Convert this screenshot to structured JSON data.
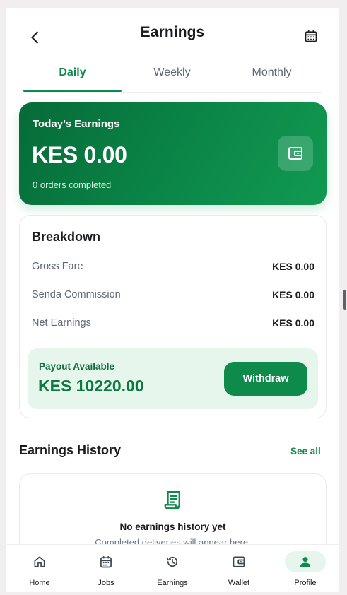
{
  "header": {
    "title": "Earnings",
    "back_icon": "chevron-left-icon",
    "calendar_icon": "calendar-icon"
  },
  "tabs": [
    {
      "label": "Daily",
      "active": true
    },
    {
      "label": "Weekly",
      "active": false
    },
    {
      "label": "Monthly",
      "active": false
    }
  ],
  "today": {
    "label": "Today’s Earnings",
    "amount": "KES 0.00",
    "orders": "0 orders completed",
    "icon": "wallet-icon"
  },
  "breakdown": {
    "title": "Breakdown",
    "rows": [
      {
        "label": "Gross Fare",
        "value": "KES 0.00"
      },
      {
        "label": "Senda Commission",
        "value": "KES 0.00"
      },
      {
        "label": "Net Earnings",
        "value": "KES 0.00"
      }
    ],
    "payout": {
      "label": "Payout Available",
      "amount": "KES 10220.00",
      "button": "Withdraw"
    }
  },
  "history": {
    "title": "Earnings History",
    "see_all": "See all",
    "empty_title": "No earnings history yet",
    "empty_subtitle": "Completed deliveries will appear here."
  },
  "nav": [
    {
      "label": "Home",
      "icon": "home-icon",
      "active": false
    },
    {
      "label": "Jobs",
      "icon": "calendar-icon",
      "active": false
    },
    {
      "label": "Earnings",
      "icon": "history-icon",
      "active": false
    },
    {
      "label": "Wallet",
      "icon": "wallet-icon",
      "active": false
    },
    {
      "label": "Profile",
      "icon": "person-icon",
      "active": true
    }
  ],
  "colors": {
    "primary": "#0e8a4b",
    "primary_dark": "#066b38",
    "payout_bg": "#e6f6ec",
    "text": "#1b1b1f",
    "muted": "#5c6878"
  }
}
